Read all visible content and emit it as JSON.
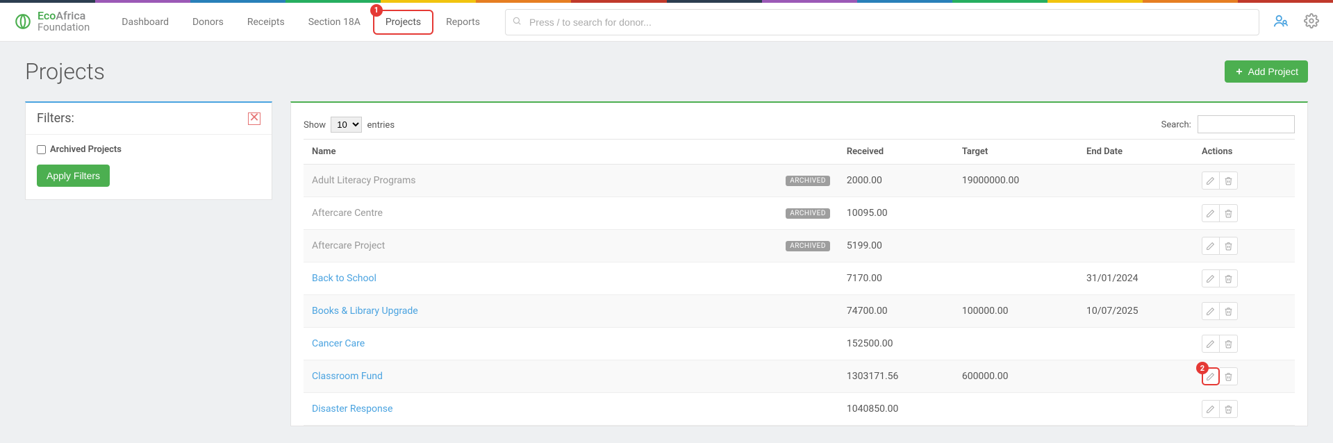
{
  "accent_colors": [
    "#2c3e50",
    "#9b59b6",
    "#2980b9",
    "#27ae60",
    "#f1c40f",
    "#e67e22",
    "#c0392b",
    "#2c3e50",
    "#9b59b6",
    "#2980b9",
    "#27ae60",
    "#f1c40f",
    "#e67e22",
    "#c0392b"
  ],
  "logo": {
    "line1a": "Eco",
    "line1b": "Africa",
    "line2": "Foundation"
  },
  "nav": {
    "items": [
      "Dashboard",
      "Donors",
      "Receipts",
      "Section 18A",
      "Projects",
      "Reports"
    ],
    "active_index": 4,
    "active_badge": "1"
  },
  "search": {
    "placeholder": "Press / to search for donor..."
  },
  "page": {
    "title": "Projects",
    "add_button": "Add Project"
  },
  "filters": {
    "title": "Filters:",
    "archived_label": "Archived Projects",
    "apply_label": "Apply Filters"
  },
  "table_controls": {
    "show_label": "Show",
    "entries_label": "entries",
    "page_size_options": [
      "10"
    ],
    "search_label": "Search:"
  },
  "columns": [
    "Name",
    "Received",
    "Target",
    "End Date",
    "Actions"
  ],
  "rows": [
    {
      "name": "Adult Literacy Programs",
      "archived": true,
      "received": "2000.00",
      "target": "19000000.00",
      "end_date": ""
    },
    {
      "name": "Aftercare Centre",
      "archived": true,
      "received": "10095.00",
      "target": "",
      "end_date": ""
    },
    {
      "name": "Aftercare Project",
      "archived": true,
      "received": "5199.00",
      "target": "",
      "end_date": ""
    },
    {
      "name": "Back to School",
      "archived": false,
      "received": "7170.00",
      "target": "",
      "end_date": "31/01/2024"
    },
    {
      "name": "Books & Library Upgrade",
      "archived": false,
      "received": "74700.00",
      "target": "100000.00",
      "end_date": "10/07/2025"
    },
    {
      "name": "Cancer Care",
      "archived": false,
      "received": "152500.00",
      "target": "",
      "end_date": ""
    },
    {
      "name": "Classroom Fund",
      "archived": false,
      "received": "1303171.56",
      "target": "600000.00",
      "end_date": "",
      "edit_highlight": true,
      "edit_badge": "2"
    },
    {
      "name": "Disaster Response",
      "archived": false,
      "received": "1040850.00",
      "target": "",
      "end_date": ""
    }
  ],
  "archived_badge_text": "ARCHIVED"
}
